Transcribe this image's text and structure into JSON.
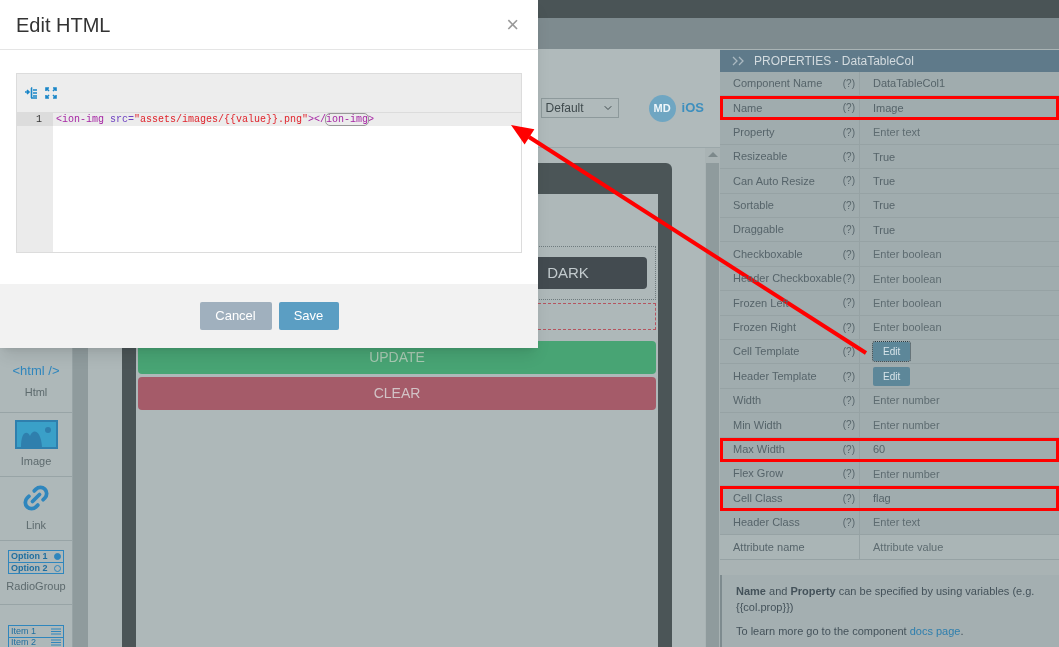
{
  "dialog": {
    "title": "Edit HTML",
    "close": "×",
    "editor": {
      "lines": [
        {
          "number": "1",
          "active": true,
          "tokens": [
            {
              "kind": "tag",
              "text": "<ion-img"
            },
            {
              "kind": "attr",
              "text": " src="
            },
            {
              "kind": "string",
              "text": "\"assets/images/{{value}}.png\""
            },
            {
              "kind": "tag",
              "text": "></"
            },
            {
              "kind": "match",
              "text": "ion-img"
            },
            {
              "kind": "tag",
              "text": ">"
            }
          ]
        }
      ]
    },
    "buttons": [
      {
        "kind": "secondary",
        "label": "Cancel"
      },
      {
        "kind": "primary",
        "label": "Save"
      }
    ]
  },
  "toolbar": {
    "theme_select": "Default",
    "platforms": [
      {
        "label": "MD",
        "selected": true
      },
      {
        "label": "iOS",
        "selected": false
      }
    ]
  },
  "palette": [
    {
      "kind": "html",
      "icon_text": "<html />",
      "label": "Html"
    },
    {
      "kind": "image",
      "label": "Image"
    },
    {
      "kind": "link",
      "label": "Link"
    },
    {
      "kind": "radio",
      "options": [
        "Option 1",
        "Option 2"
      ],
      "label": "RadioGroup"
    },
    {
      "kind": "list",
      "options": [
        "Item 1",
        "Item 2"
      ]
    }
  ],
  "preview": {
    "buttons": [
      {
        "kind": "dark",
        "label": "DARK"
      },
      {
        "kind": "success",
        "label": "UPDATE"
      },
      {
        "kind": "danger",
        "label": "CLEAR"
      }
    ]
  },
  "properties": {
    "title": "PROPERTIES - DataTableCol",
    "rows": [
      {
        "kind": "input",
        "label": "Component Name",
        "help": "(?)",
        "value": "DataTableCol1",
        "highlighted": false
      },
      {
        "kind": "input",
        "label": "Name",
        "help": "(?)",
        "value": "Image",
        "highlighted": true
      },
      {
        "kind": "input",
        "label": "Property",
        "help": "(?)",
        "placeholder": "Enter text",
        "highlighted": false
      },
      {
        "kind": "input",
        "label": "Resizeable",
        "help": "(?)",
        "value": "True",
        "highlighted": false
      },
      {
        "kind": "input",
        "label": "Can Auto Resize",
        "help": "(?)",
        "value": "True",
        "highlighted": false
      },
      {
        "kind": "input",
        "label": "Sortable",
        "help": "(?)",
        "value": "True",
        "highlighted": false
      },
      {
        "kind": "input",
        "label": "Draggable",
        "help": "(?)",
        "value": "True",
        "highlighted": false
      },
      {
        "kind": "input",
        "label": "Checkboxable",
        "help": "(?)",
        "placeholder": "Enter boolean",
        "highlighted": false
      },
      {
        "kind": "input",
        "label": "Header Checkboxable",
        "help": "(?)",
        "placeholder": "Enter boolean",
        "highlighted": false
      },
      {
        "kind": "input",
        "label": "Frozen Left",
        "help": "(?)",
        "placeholder": "Enter boolean",
        "highlighted": false
      },
      {
        "kind": "input",
        "label": "Frozen Right",
        "help": "(?)",
        "placeholder": "Enter boolean",
        "highlighted": false
      },
      {
        "kind": "button",
        "label": "Cell Template",
        "help": "(?)",
        "button": "Edit",
        "focused": true,
        "highlighted": false
      },
      {
        "kind": "button",
        "label": "Header Template",
        "help": "(?)",
        "button": "Edit",
        "focused": false,
        "highlighted": false
      },
      {
        "kind": "input",
        "label": "Width",
        "help": "(?)",
        "placeholder": "Enter number",
        "highlighted": false
      },
      {
        "kind": "input",
        "label": "Min Width",
        "help": "(?)",
        "placeholder": "Enter number",
        "highlighted": false
      },
      {
        "kind": "input",
        "label": "Max Width",
        "help": "(?)",
        "value": "60",
        "highlighted": true
      },
      {
        "kind": "input",
        "label": "Flex Grow",
        "help": "(?)",
        "placeholder": "Enter number",
        "highlighted": false
      },
      {
        "kind": "input",
        "label": "Cell Class",
        "help": "(?)",
        "value": "flag",
        "highlighted": true
      },
      {
        "kind": "input",
        "label": "Header Class",
        "help": "(?)",
        "placeholder": "Enter text",
        "highlighted": false
      },
      {
        "kind": "attribute",
        "label": "Attribute name",
        "placeholder": "Attribute value",
        "highlighted": false
      }
    ],
    "note": {
      "text": "**Name** and **Property** can be specified by using variables (e.g. {{col.prop}})",
      "more": "To learn more go to the component ",
      "link": "docs page",
      "end": "."
    }
  }
}
